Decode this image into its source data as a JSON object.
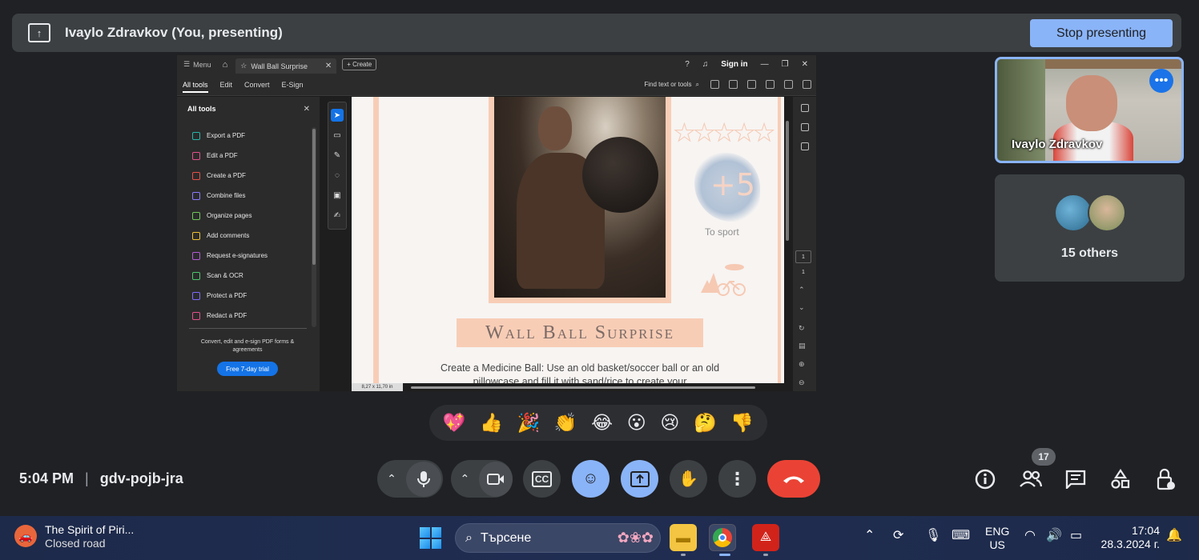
{
  "present_bar": {
    "title": "Ivaylo Zdravkov (You, presenting)",
    "stop_label": "Stop presenting"
  },
  "acrobat": {
    "menu_label": "Menu",
    "tab_title": "Wall Ball Surprise",
    "create_label": "Create",
    "sign_in": "Sign in",
    "toolbar_tabs": [
      "All tools",
      "Edit",
      "Convert",
      "E-Sign"
    ],
    "find_label": "Find text or tools",
    "side_title": "All tools",
    "tools": [
      {
        "label": "Export a PDF",
        "color": "#26b5a8"
      },
      {
        "label": "Edit a PDF",
        "color": "#e6508c"
      },
      {
        "label": "Create a PDF",
        "color": "#e8504a"
      },
      {
        "label": "Combine files",
        "color": "#8a7bff"
      },
      {
        "label": "Organize pages",
        "color": "#6fc85a"
      },
      {
        "label": "Add comments",
        "color": "#f2c230"
      },
      {
        "label": "Request e-signatures",
        "color": "#b45ad8"
      },
      {
        "label": "Scan & OCR",
        "color": "#4cc86a"
      },
      {
        "label": "Protect a PDF",
        "color": "#7d6cff"
      },
      {
        "label": "Redact a PDF",
        "color": "#e6508c"
      }
    ],
    "promo_text": "Convert, edit and e-sign PDF forms & agreements",
    "trial_label": "Free 7-day trial",
    "page_current": "1",
    "page_total": "1",
    "page_size": "8,27 x 11,70 in"
  },
  "pdf": {
    "plus": "+5",
    "to_sport": "To sport",
    "title": "Wall Ball Surprise",
    "body": "Create a Medicine Ball: Use an old basket/soccer ball or an old pillowcase and fill it with sand/rice to create your"
  },
  "tiles": {
    "self_name": "Ivaylo Zdravkov",
    "others_label": "15 others"
  },
  "reactions": [
    "💖",
    "👍",
    "🎉",
    "👏",
    "😂",
    "😮",
    "😢",
    "🤔",
    "👎"
  ],
  "footer": {
    "time": "5:04 PM",
    "meeting_code": "gdv-pojb-jra",
    "people_count": "17"
  },
  "taskbar": {
    "weather_title": "The Spirit of Piri...",
    "weather_sub": "Closed road",
    "search_placeholder": "Търсене",
    "lang_top": "ENG",
    "lang_bottom": "US",
    "time": "17:04",
    "date": "28.3.2024 г."
  },
  "colors": {
    "accent": "#8ab4f8",
    "end_call": "#ea4335",
    "peach": "#f8cdb6"
  }
}
